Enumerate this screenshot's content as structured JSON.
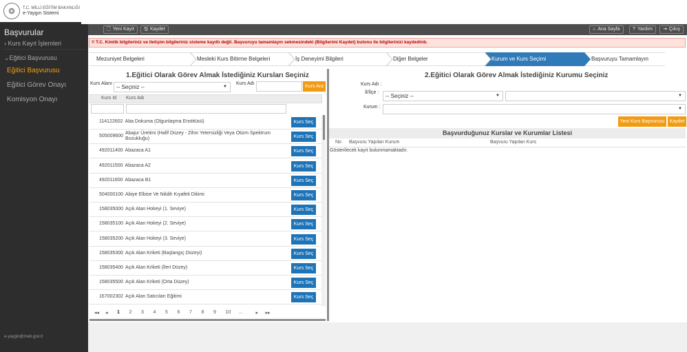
{
  "brand": {
    "line1": "T.C. MİLLİ EĞİTİM BAKANLIĞI",
    "line2": "e-Yaygın Sistemi"
  },
  "sidebar": {
    "title": "Başvurular",
    "items": [
      {
        "label": "› Kurs Kayıt İşlemleri"
      },
      {
        "label": "⌄Eğitici Başvurusu"
      },
      {
        "label": "Eğitici Başvurusu"
      },
      {
        "label": "Eğitici Görev Onayı"
      },
      {
        "label": "Komisyon Onayı"
      }
    ],
    "footer_email": "e-yaygin@meb.gov.tr"
  },
  "toolbar": {
    "new_record": "Yeni Kayıt",
    "save": "Kaydet",
    "home": "Ana Sayfa",
    "help": "Yardım",
    "exit": "Çıkış"
  },
  "warning": "!! T.C. Kimlik bilgileriniz ve iletişim bilgileriniz sisteme kayıtlı değil. Başvuruyu tamamlayın sekmesindeki (Bilgilerimi Kaydet) butonu ile bilgilerinizi kaydedinb.",
  "steps": [
    {
      "label": "Mezuniyet Belgeleri"
    },
    {
      "label": "Mesleki Kurs Bitirme Belgeleri"
    },
    {
      "label": "İş Deneyimi Bilgileri"
    },
    {
      "label": "Diğer Belgeler"
    },
    {
      "label": "Kurum ve Kurs Seçimi",
      "active": true
    },
    {
      "label": "Başvuruyu Tamamlayın"
    }
  ],
  "left": {
    "title": "1.Eğitici Olarak Görev Almak İstediğiniz Kursları Seçiniz",
    "kurs_alani_label": "Kurs Alanı",
    "kurs_alani_value": "-- Seçiniz --",
    "kurs_adi_label": "Kurs Adı",
    "search_button": "Kurs Ara",
    "col_id": "Kurs Id",
    "col_name": "Kurs Adı",
    "select_label": "Kurs Seç",
    "courses": [
      {
        "id": "114122602",
        "name": "Aba Dokuma (Olgunlaşma Enstitüsü)"
      },
      {
        "id": "505009600",
        "name": "Abajur Üretimi (Hafif Düzey - Zihin Yetersizliği Veya Otizm Spektrum Bozukluğu)"
      },
      {
        "id": "492011400",
        "name": "Abazaca A1"
      },
      {
        "id": "492011500",
        "name": "Abazaca A2"
      },
      {
        "id": "492011600",
        "name": "Abazaca B1"
      },
      {
        "id": "504000100",
        "name": "Abiye Elbise Ve Nikâh Kıyafeti Dikimi"
      },
      {
        "id": "158035000",
        "name": "Açık Alan Hokeyi (1. Seviye)"
      },
      {
        "id": "158035100",
        "name": "Açık Alan Hokeyi (2. Seviye)"
      },
      {
        "id": "158035200",
        "name": "Açık Alan Hokeyi (3. Seviye)"
      },
      {
        "id": "158035300",
        "name": "Açık Alan Kriketi (Başlangıç Düzeyi)"
      },
      {
        "id": "158035400",
        "name": "Açık Alan Kriketi (İleri Düzey)"
      },
      {
        "id": "158035500",
        "name": "Açık Alan Kriketi (Orta Düzey)"
      },
      {
        "id": "167002302",
        "name": "Açık Alan Satıcıları Eğitimi"
      }
    ],
    "pager": [
      "1",
      "2",
      "3",
      "4",
      "5",
      "6",
      "7",
      "8",
      "9",
      "10",
      "..."
    ],
    "pager_current": "1"
  },
  "right": {
    "title": "2.Eğitici Olarak Görev Almak İstediğiniz Kurumu Seçiniz",
    "kurs_adi_label": "Kurs Adı :",
    "il_ilce_label": "İl/İlçe :",
    "il_value": "-- Seçiniz --",
    "kurum_label": "Kurum :",
    "new_application_button": "Yeni Kurs Başvurusu",
    "save_button": "Kaydet",
    "list_title": "Başvurduğunuz Kurslar ve Kurumlar Listesi",
    "col_no": "No",
    "col_kurum": "Başvuru Yapılan Kurum",
    "col_kurs": "Başvuru Yapılan Kurs",
    "empty_text": "Gösterilecek kayıt bulunmamaktadır."
  },
  "colors": {
    "sidebar": "#2d2d2d",
    "accent_orange": "#f29a10",
    "accent_blue": "#1e73b7",
    "active_step": "#2f7ab8",
    "warning_bg": "#fde2dd"
  }
}
